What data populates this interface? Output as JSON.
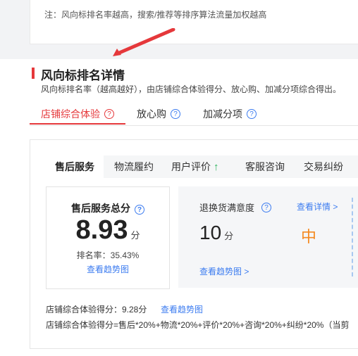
{
  "note": "注：风向标排名率越高，搜索/推荐等排序算法流量加权越高",
  "section": {
    "title": "风向标排名详情",
    "subtitle": "风向标排名率（越高越好），由店铺综合体验得分、放心购、加减分项综合得出。"
  },
  "tabs": [
    {
      "label": "店铺综合体验",
      "help": "?"
    },
    {
      "label": "放心购",
      "help": "?"
    },
    {
      "label": "加减分项",
      "help": "?"
    }
  ],
  "subtabs": [
    "售后服务",
    "物流履约",
    "用户评价",
    "客服咨询",
    "交易纠纷"
  ],
  "subtab_arrow": "↑",
  "score_card": {
    "label": "售后服务总分",
    "help": "?",
    "value": "8.93",
    "unit": "分",
    "rank": "排名率：35.43%",
    "trend_link": "查看趋势图"
  },
  "detail_card": {
    "label": "退换货满意度",
    "help": "?",
    "detail_link": "查看详情 >",
    "value": "10",
    "unit": "分",
    "level": "中",
    "trend_link": "查看趋势图 >"
  },
  "footer": {
    "score_text": "店铺综合体验得分：9.28分",
    "score_link": "查看趋势图",
    "formula": "店铺综合体验得分=售后*20%+物流*20%+评价*20%+咨询*20%+纠纷*20%（当剪"
  },
  "colors": {
    "accent": "#e5383b",
    "link": "#3c7cf0",
    "level": "#f5891f",
    "up": "#2bb45c"
  }
}
